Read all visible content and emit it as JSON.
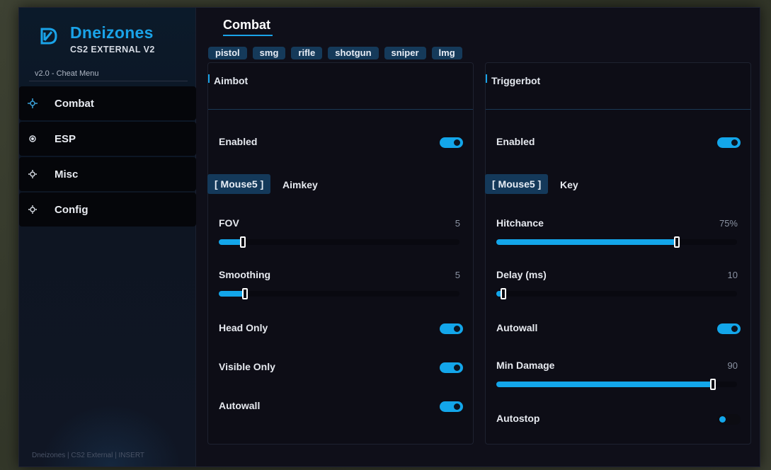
{
  "brand": {
    "name": "Dneizones",
    "subtitle": "CS2 EXTERNAL V2",
    "version": "v2.0 - Cheat Menu"
  },
  "sidebar": {
    "items": [
      {
        "label": "Combat",
        "icon": "crosshair-icon"
      },
      {
        "label": "ESP",
        "icon": "eye-icon"
      },
      {
        "label": "Misc",
        "icon": "gear-icon"
      },
      {
        "label": "Config",
        "icon": "gear-icon"
      }
    ],
    "footer": "Dneizones  |  CS2 External  |  INSERT"
  },
  "page": {
    "title": "Combat"
  },
  "weapon_tabs": [
    "pistol",
    "smg",
    "rifle",
    "shotgun",
    "sniper",
    "lmg"
  ],
  "colors": {
    "accent": "#13a6ea",
    "brand": "#1aa3e8",
    "panel": "#0d0d16",
    "tab_bg": "#153a5a"
  },
  "aimbot": {
    "title": "Aimbot",
    "enabled_label": "Enabled",
    "enabled": true,
    "key_value": "[ Mouse5 ]",
    "key_label": "Aimkey",
    "fov_label": "FOV",
    "fov_value": "5",
    "fov_fraction": 0.1,
    "smoothing_label": "Smoothing",
    "smoothing_value": "5",
    "smoothing_fraction": 0.11,
    "head_only_label": "Head Only",
    "head_only": true,
    "visible_only_label": "Visible Only",
    "visible_only": true,
    "autowall_label": "Autowall",
    "autowall": true
  },
  "triggerbot": {
    "title": "Triggerbot",
    "enabled_label": "Enabled",
    "enabled": true,
    "key_value": "[ Mouse5 ]",
    "key_label": "Key",
    "hitchance_label": "Hitchance",
    "hitchance_value": "75%",
    "hitchance_fraction": 0.75,
    "delay_label": "Delay (ms)",
    "delay_value": "10",
    "delay_fraction": 0.03,
    "autowall_label": "Autowall",
    "autowall": true,
    "min_damage_label": "Min Damage",
    "min_damage_value": "90",
    "min_damage_fraction": 0.9,
    "autostop_label": "Autostop",
    "autostop": false
  }
}
